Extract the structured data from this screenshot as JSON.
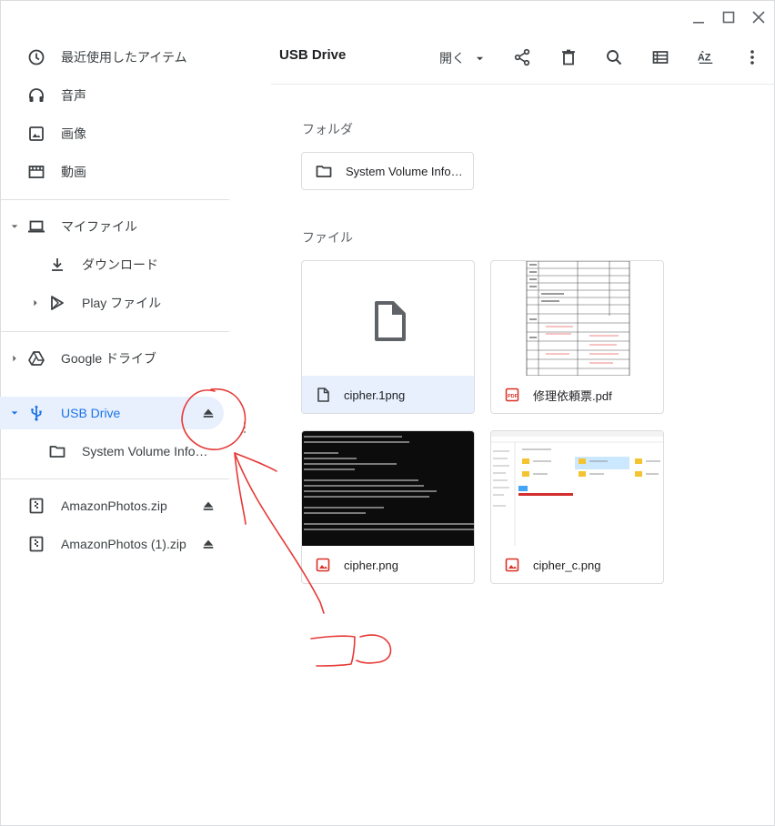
{
  "sidebar": {
    "items": [
      {
        "label": "最近使用したアイテム",
        "icon": "clock-icon"
      },
      {
        "label": "音声",
        "icon": "headphones-icon"
      },
      {
        "label": "画像",
        "icon": "image-icon"
      },
      {
        "label": "動画",
        "icon": "video-icon"
      },
      {
        "label": "マイファイル",
        "icon": "laptop-icon"
      },
      {
        "label": "ダウンロード",
        "icon": "download-icon"
      },
      {
        "label": "Play ファイル",
        "icon": "play-icon"
      },
      {
        "label": "Google ドライブ",
        "icon": "drive-icon"
      },
      {
        "label": "USB Drive",
        "icon": "usb-icon"
      },
      {
        "label": "System Volume Information",
        "icon": "folder-icon"
      },
      {
        "label": "AmazonPhotos.zip",
        "icon": "zip-icon"
      },
      {
        "label": "AmazonPhotos (1).zip",
        "icon": "zip-icon"
      }
    ]
  },
  "toolbar": {
    "title": "USB Drive",
    "open_label": "開く",
    "buttons": [
      "share-icon",
      "delete-icon",
      "search-icon",
      "list-view-icon",
      "sort-az-icon",
      "more-icon"
    ]
  },
  "main": {
    "folders_label": "フォルダ",
    "files_label": "ファイル",
    "folders": [
      {
        "name": "System Volume Information"
      }
    ],
    "files": [
      {
        "name": "cipher.1png",
        "type": "generic"
      },
      {
        "name": "修理依頼票.pdf",
        "type": "pdf"
      },
      {
        "name": "cipher.png",
        "type": "image"
      },
      {
        "name": "cipher_c.png",
        "type": "image"
      }
    ]
  },
  "annotation": {
    "text": "ココ",
    "color": "#e53935"
  },
  "colors": {
    "accent": "#1a73e8",
    "active_bg": "#e8f0fe",
    "pdf_red": "#d93025"
  }
}
